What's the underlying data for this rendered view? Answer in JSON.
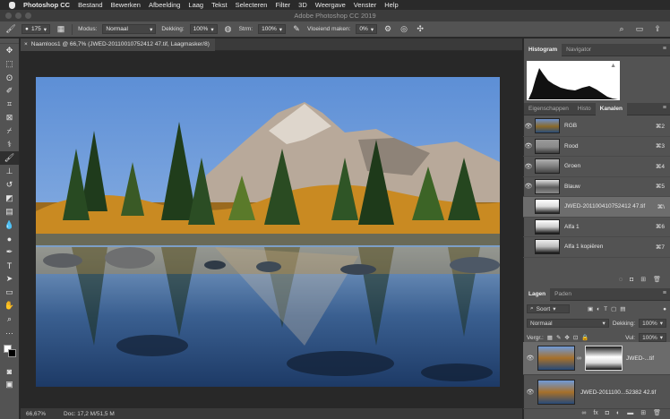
{
  "menubar": {
    "app": "Photoshop CC",
    "items": [
      "Bestand",
      "Bewerken",
      "Afbeelding",
      "Laag",
      "Tekst",
      "Selecteren",
      "Filter",
      "3D",
      "Weergave",
      "Venster",
      "Help"
    ]
  },
  "window": {
    "title": "Adobe Photoshop CC 2019"
  },
  "options": {
    "brush_size": "175",
    "mode_label": "Modus:",
    "mode_value": "Normaal",
    "opacity_label": "Dekking:",
    "opacity_value": "100%",
    "flow_label": "Strm:",
    "flow_value": "100%",
    "smoothing_label": "Vloeiend maken:",
    "smoothing_value": "0%"
  },
  "document": {
    "tab_title": "Naamloos1 @ 66,7% (JWED-20110010752412 47.tif, Laagmasker/8)",
    "zoom": "66,67%",
    "doc_info": "Doc: 17,2 M/51,5 M"
  },
  "panels": {
    "top_tabs": [
      "Histogram",
      "Navigator"
    ],
    "mid_tabs": [
      "Eigenschappen",
      "Histo",
      "Kanalen"
    ],
    "layers_tabs": [
      "Lagen",
      "Paden"
    ],
    "channels": [
      {
        "name": "RGB",
        "shortcut": "⌘2"
      },
      {
        "name": "Rood",
        "shortcut": "⌘3"
      },
      {
        "name": "Groen",
        "shortcut": "⌘4"
      },
      {
        "name": "Blauw",
        "shortcut": "⌘5"
      },
      {
        "name": "JWED-201100410752412 47.tif ...",
        "shortcut": "⌘\\"
      },
      {
        "name": "Alfa 1",
        "shortcut": "⌘6"
      },
      {
        "name": "Alfa 1 kopiëren",
        "shortcut": "⌘7"
      }
    ],
    "layers": {
      "filter_label": "Soort",
      "blend_mode": "Normaal",
      "opacity_label": "Dekking:",
      "opacity_value": "100%",
      "lock_label": "Vergr.:",
      "fill_label": "Vul:",
      "fill_value": "100%",
      "rows": [
        {
          "name": "JWED-...tif"
        },
        {
          "name": "JWED-2011100...52382 42.tif"
        }
      ]
    }
  },
  "colors": {
    "accent_bg": "#535353",
    "dark_bg": "#282828"
  }
}
